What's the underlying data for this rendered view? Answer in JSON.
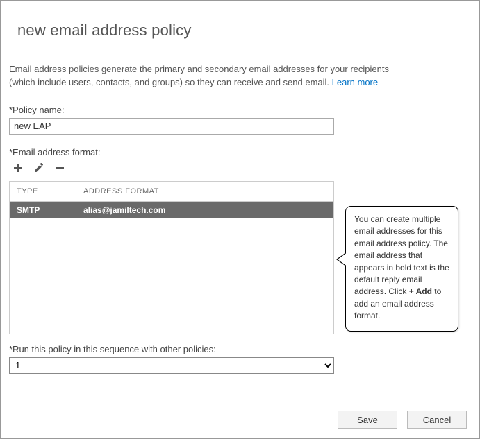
{
  "title": "new email address policy",
  "intro": {
    "text": "Email address policies generate the primary and secondary email addresses for your recipients (which include users, contacts, and groups) so they can receive and send email. ",
    "link_text": "Learn more"
  },
  "policy_name": {
    "label": "*Policy name:",
    "value": "new EAP"
  },
  "email_format": {
    "label": "*Email address format:",
    "columns": {
      "type": "TYPE",
      "format": "ADDRESS FORMAT"
    },
    "rows": [
      {
        "type": "SMTP",
        "format": "alias@jamiltech.com"
      }
    ]
  },
  "sequence": {
    "label": "*Run this policy in this sequence with other policies:",
    "value": "1"
  },
  "tooltip": {
    "part1": "You can create multiple email addresses for this email address policy. The email address that appears in bold text is the default reply email address. Click ",
    "plus_add": "+ Add",
    "part2": " to add an email address format."
  },
  "buttons": {
    "save": "Save",
    "cancel": "Cancel"
  }
}
